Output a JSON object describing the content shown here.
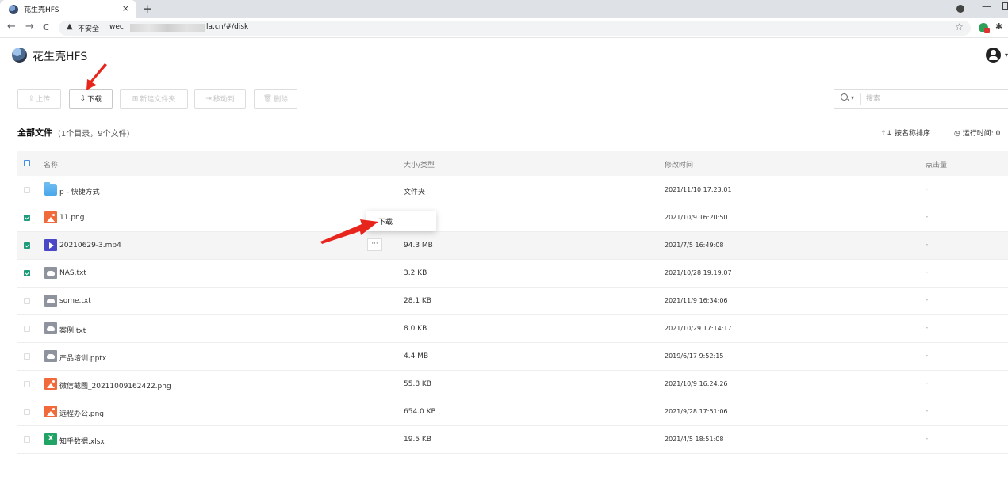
{
  "browser": {
    "tab_title": "花生壳HFS",
    "tab_close": "×",
    "new_tab": "+",
    "insecure_label": "不安全",
    "url_start": "wec",
    "url_end": "la.cn/#/disk",
    "back_glyph": "←",
    "forward_glyph": "→",
    "reload_glyph": "C",
    "warn_glyph": "▲",
    "star_glyph": "☆",
    "extensions_glyph": "✱",
    "minimize_glyph": "—"
  },
  "app": {
    "title": "花生壳HFS",
    "user_caret": "▾"
  },
  "actions": {
    "upload": "上传",
    "download": "下载",
    "new_folder": "新建文件夹",
    "move_to": "移动到",
    "delete": "删除",
    "upload_icon": "⇪",
    "download_icon": "⇩",
    "new_folder_icon": "⊞",
    "move_icon": "⇥",
    "delete_icon": "🗑"
  },
  "search": {
    "placeholder": "搜索",
    "caret": "▾"
  },
  "files_header": {
    "title": "全部文件",
    "count": "(1个目录，9个文件)",
    "sort": "↑↓ 按名称排序",
    "runtime": "◷ 运行时间: 0"
  },
  "table": {
    "col_name": "名称",
    "col_size": "大小/类型",
    "col_time": "修改时间",
    "col_clicks": "点击量"
  },
  "files": [
    {
      "name": "p - 快捷方式",
      "size": "文件夹",
      "time": "2021/11/10 17:23:01",
      "clicks": "-",
      "type": "folder",
      "checked": false
    },
    {
      "name": "11.png",
      "size": "",
      "time": "2021/10/9 16:20:50",
      "clicks": "-",
      "type": "img",
      "checked": true
    },
    {
      "name": "20210629-3.mp4",
      "size": "94.3 MB",
      "time": "2021/7/5 16:49:08",
      "clicks": "-",
      "type": "video",
      "checked": true
    },
    {
      "name": "NAS.txt",
      "size": "3.2 KB",
      "time": "2021/10/28 19:19:07",
      "clicks": "-",
      "type": "doc",
      "checked": true
    },
    {
      "name": "some.txt",
      "size": "28.1 KB",
      "time": "2021/11/9 16:34:06",
      "clicks": "-",
      "type": "doc",
      "checked": false
    },
    {
      "name": "案例.txt",
      "size": "8.0 KB",
      "time": "2021/10/29 17:14:17",
      "clicks": "-",
      "type": "doc",
      "checked": false
    },
    {
      "name": "产品培训.pptx",
      "size": "4.4 MB",
      "time": "2019/6/17 9:52:15",
      "clicks": "-",
      "type": "doc",
      "checked": false
    },
    {
      "name": "微信截图_20211009162422.png",
      "size": "55.8 KB",
      "time": "2021/10/9 16:24:26",
      "clicks": "-",
      "type": "img",
      "checked": false
    },
    {
      "name": "远程办公.png",
      "size": "654.0 KB",
      "time": "2021/9/28 17:51:06",
      "clicks": "-",
      "type": "img",
      "checked": false
    },
    {
      "name": "知乎数据.xlsx",
      "size": "19.5 KB",
      "time": "2021/4/5 18:51:08",
      "clicks": "-",
      "type": "xls",
      "checked": false
    }
  ],
  "row_actions": {
    "more": "···",
    "menu_download": "下载"
  }
}
